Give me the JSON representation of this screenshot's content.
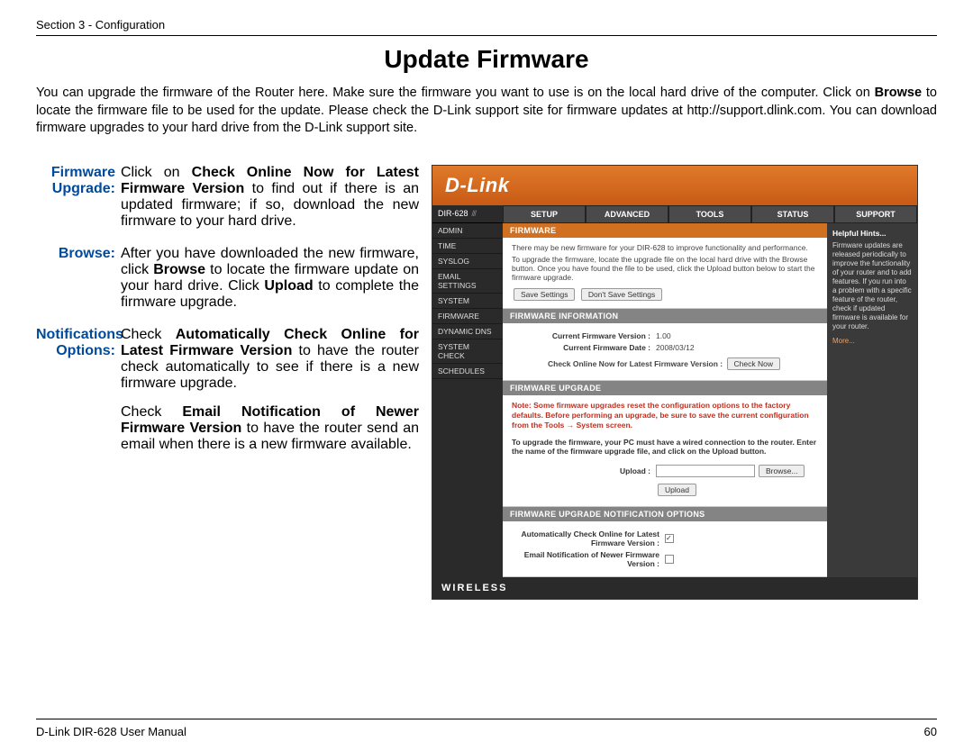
{
  "header": {
    "section": "Section 3 - Configuration"
  },
  "title": "Update Firmware",
  "intro_parts": {
    "a": "You can upgrade the firmware of the Router here. Make sure the firmware you want to use is on the local hard drive of the computer. Click on ",
    "b": "Browse",
    "c": " to locate the firmware file to be used for the update. Please check the D-Link support site for firmware updates at http://support.dlink.com. You can download firmware upgrades to your hard drive from the D-Link support site."
  },
  "defs": [
    {
      "label_line1": "Firmware",
      "label_line2": "Upgrade:",
      "p": [
        "Click on ",
        "Check Online Now for Latest Firmware Version",
        " to find out if there is an updated firmware; if so, download the new firmware to your hard drive."
      ]
    },
    {
      "label_line1": "Browse:",
      "label_line2": "",
      "p": [
        "After you have downloaded the new firmware, click ",
        "Browse",
        " to locate the firmware update on your hard drive.  Click ",
        "Upload",
        " to complete the firmware upgrade."
      ]
    },
    {
      "label_line1": "Notifications",
      "label_line2": "Options:",
      "p": [
        "Check ",
        "Automatically Check Online for Latest Firmware Version",
        " to have the router check automatically to see if there is a new firmware upgrade."
      ],
      "p2": [
        "Check ",
        "Email Notification of Newer Firmware Version",
        " to have the router send an email when there is a new firmware available."
      ]
    }
  ],
  "router": {
    "brand": "D-Link",
    "model": "DIR-628",
    "tabs": [
      "SETUP",
      "ADVANCED",
      "TOOLS",
      "STATUS",
      "SUPPORT"
    ],
    "side": [
      "ADMIN",
      "TIME",
      "SYSLOG",
      "EMAIL SETTINGS",
      "SYSTEM",
      "FIRMWARE",
      "DYNAMIC DNS",
      "SYSTEM CHECK",
      "SCHEDULES"
    ],
    "hints_title": "Helpful Hints...",
    "hints_body": "Firmware updates are released periodically to improve the functionality of your router and to add features. If you run into a problem with a specific feature of the router, check if updated firmware is available for your router.",
    "hints_more": "More...",
    "firmware_intro": "There may be new firmware for your DIR-628 to improve functionality and performance.",
    "firmware_intro2": "To upgrade the firmware, locate the upgrade file on the local hard drive with the Browse button. Once you have found the file to be used, click the Upload button below to start the firmware upgrade.",
    "save": "Save Settings",
    "dontsave": "Don't Save Settings",
    "sec1": "FIRMWARE",
    "sec2": "FIRMWARE INFORMATION",
    "cur_ver_label": "Current Firmware Version :",
    "cur_ver": "1.00",
    "cur_date_label": "Current Firmware Date :",
    "cur_date": "2008/03/12",
    "check_label": "Check Online Now for Latest Firmware Version :",
    "check_btn": "Check Now",
    "sec3": "FIRMWARE UPGRADE",
    "note": "Note: Some firmware upgrades reset the configuration options to the factory defaults. Before performing an upgrade, be sure to save the current configuration from the Tools → System screen.",
    "upg_text": "To upgrade the firmware, your PC must have a wired connection to the router. Enter the name of the firmware upgrade file, and click on the Upload button.",
    "upload_label": "Upload :",
    "browse_btn": "Browse...",
    "upload_btn": "Upload",
    "sec4": "FIRMWARE UPGRADE NOTIFICATION OPTIONS",
    "auto_label": "Automatically Check Online for Latest Firmware Version :",
    "email_label": "Email Notification of Newer Firmware Version :",
    "wireless": "WIRELESS"
  },
  "footer": {
    "left": "D-Link DIR-628 User Manual",
    "right": "60"
  }
}
